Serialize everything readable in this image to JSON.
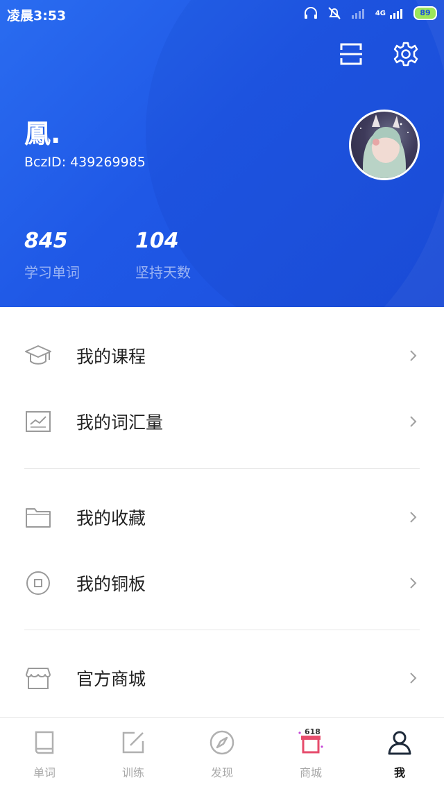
{
  "status_bar": {
    "time": "凌晨3:53",
    "battery": "89",
    "network": "4G"
  },
  "header": {
    "username": "鳳.",
    "id_label": "BczID:",
    "id_value": "439269985",
    "stats": [
      {
        "value": "845",
        "label": "学习单词"
      },
      {
        "value": "104",
        "label": "坚持天数"
      }
    ]
  },
  "menu": [
    {
      "label": "我的课程",
      "icon": "graduation-cap-icon"
    },
    {
      "label": "我的词汇量",
      "icon": "chart-icon"
    },
    {
      "label": "我的收藏",
      "icon": "folder-icon"
    },
    {
      "label": "我的铜板",
      "icon": "coin-icon"
    },
    {
      "label": "官方商城",
      "icon": "shop-icon"
    }
  ],
  "tabs": [
    {
      "label": "单词",
      "icon": "book-icon"
    },
    {
      "label": "训练",
      "icon": "edit-icon"
    },
    {
      "label": "发现",
      "icon": "compass-icon"
    },
    {
      "label": "商城",
      "icon": "store-icon",
      "badge": "618"
    },
    {
      "label": "我",
      "icon": "person-icon",
      "active": true
    }
  ],
  "colors": {
    "header_blue": "#1f58e6",
    "text_dark": "#222222",
    "tab_inactive": "#a9a9a9"
  }
}
